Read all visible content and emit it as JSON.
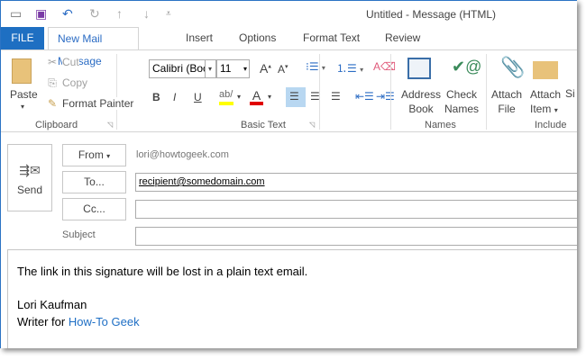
{
  "window_title": "Untitled - Message (HTML)",
  "tabs": [
    {
      "label": "FILE"
    },
    {
      "label": "New Mail Message",
      "active": true
    },
    {
      "label": "Insert"
    },
    {
      "label": "Options"
    },
    {
      "label": "Format Text"
    },
    {
      "label": "Review"
    }
  ],
  "ribbon": {
    "clipboard": {
      "paste": "Paste",
      "cut": "Cut",
      "copy": "Copy",
      "format_painter": "Format Painter",
      "label": "Clipboard"
    },
    "basic_text": {
      "font": "Calibri (Boc",
      "size": "11",
      "bold": "B",
      "italic": "I",
      "underline": "U",
      "label": "Basic Text"
    },
    "names": {
      "address_book": [
        "Address",
        "Book"
      ],
      "check_names": [
        "Check",
        "Names"
      ],
      "label": "Names"
    },
    "include": {
      "attach_file": [
        "Attach",
        "File"
      ],
      "attach_item": [
        "Attach",
        "Item"
      ],
      "signature": "Si",
      "label": "Include"
    }
  },
  "compose": {
    "send": "Send",
    "from_label": "From",
    "from_value": "lori@howtogeek.com",
    "to_label": "To...",
    "to_value": "recipient@somedomain.com",
    "cc_label": "Cc...",
    "cc_value": "",
    "subject_label": "Subject",
    "subject_value": ""
  },
  "body": {
    "line1": "The link in this signature will be lost in a plain text email.",
    "name": "Lori Kaufman",
    "writer_for": "Writer for",
    "link": "How-To Geek"
  },
  "colors": {
    "accent": "#1e6fc2",
    "highlight": "#ffff00",
    "font_color": "#e00000"
  }
}
